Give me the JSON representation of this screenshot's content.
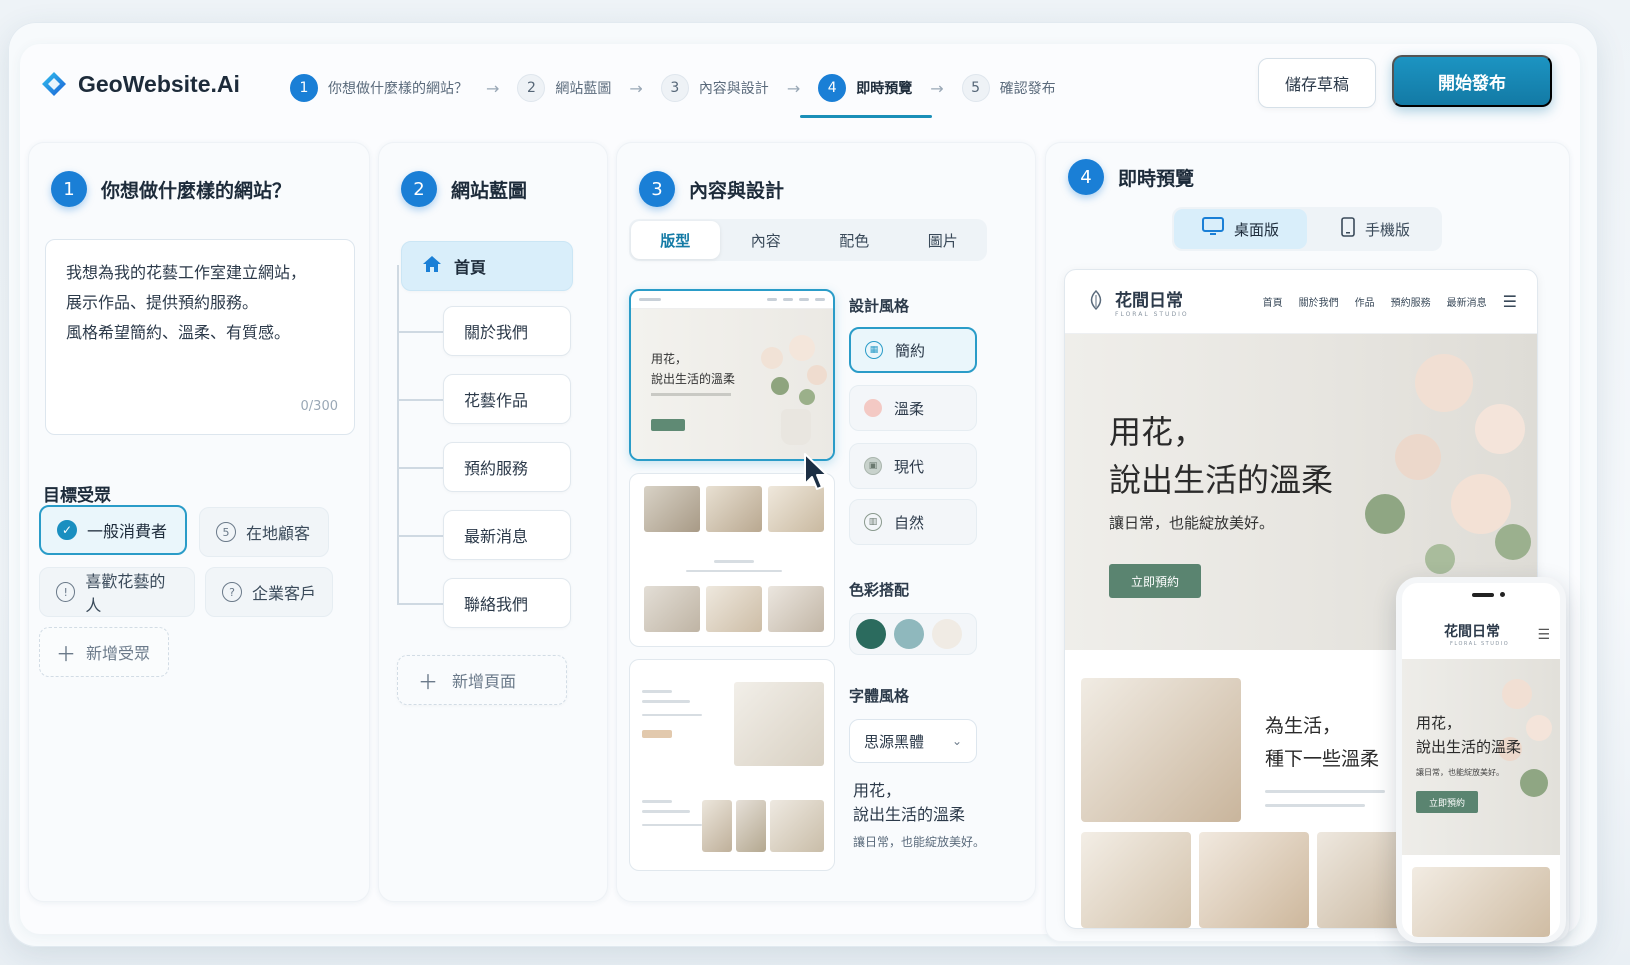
{
  "brand": {
    "name": "GeoWebsite.Ai",
    "accent": "#1a7fd6",
    "teal": "#137aa5"
  },
  "header": {
    "steps": [
      {
        "num": "1",
        "label": "你想做什麼樣的網站？"
      },
      {
        "num": "2",
        "label": "網站藍圖"
      },
      {
        "num": "3",
        "label": "內容與設計"
      },
      {
        "num": "4",
        "label": "即時預覽",
        "active": true
      },
      {
        "num": "5",
        "label": "確認發布"
      }
    ],
    "save_draft": "儲存草稿",
    "publish": "開始發布"
  },
  "panel1": {
    "num": "1",
    "title": "你想做什麼樣的網站？",
    "prompt_lines": [
      "我想為我的花藝工作室建立網站，",
      "展示作品、提供預約服務。",
      "風格希望簡約、溫柔、有質感。"
    ],
    "counter": "0/300",
    "audience_title": "目標受眾",
    "audiences": [
      {
        "label": "一般消費者",
        "icon": "check-icon",
        "selected": true
      },
      {
        "label": "在地顧客",
        "icon": "circle-icon"
      },
      {
        "label": "喜歡花藝的人",
        "icon": "alert-icon"
      },
      {
        "label": "企業客戶",
        "icon": "question-icon"
      }
    ],
    "add_audience": "新增受眾"
  },
  "panel2": {
    "num": "2",
    "title": "網站藍圖",
    "home": "首頁",
    "pages": [
      "關於我們",
      "花藝作品",
      "預約服務",
      "最新消息",
      "聯絡我們"
    ],
    "add_page": "新增頁面"
  },
  "panel3": {
    "num": "3",
    "title": "內容與設計",
    "tabs": [
      "版型",
      "內容",
      "配色",
      "圖片"
    ],
    "template1_lines": [
      "用花，",
      "說出生活的溫柔"
    ],
    "style_title": "設計風格",
    "styles": [
      "簡約",
      "溫柔",
      "現代",
      "自然"
    ],
    "color_title": "色彩搭配",
    "swatches": [
      "#2b6b5e",
      "#8fb8bd",
      "#f0ebe4"
    ],
    "font_title": "字體風格",
    "font_value": "思源黑體",
    "font_preview_lines": [
      "用花，",
      "說出生活的溫柔"
    ],
    "font_preview_sub": "讓日常，也能綻放美好。"
  },
  "panel4": {
    "num": "4",
    "title": "即時預覽",
    "desktop": "桌面版",
    "mobile": "手機版",
    "site": {
      "logo": "花間日常",
      "logo_sub": "FLORAL STUDIO",
      "menu": [
        "首頁",
        "關於我們",
        "作品",
        "預約服務",
        "最新消息"
      ],
      "hero_lines": [
        "用花，",
        "說出生活的溫柔"
      ],
      "hero_sub": "讓日常，也能綻放美好。",
      "cta": "立即預約",
      "section_lines": [
        "為生活，",
        "種下一些溫柔"
      ]
    },
    "phone": {
      "logo": "花間日常",
      "logo_sub": "FLORAL STUDIO",
      "hero_lines": [
        "用花，",
        "說出生活的溫柔"
      ],
      "hero_sub": "讓日常，也能綻放美好。",
      "cta": "立即預約"
    }
  }
}
